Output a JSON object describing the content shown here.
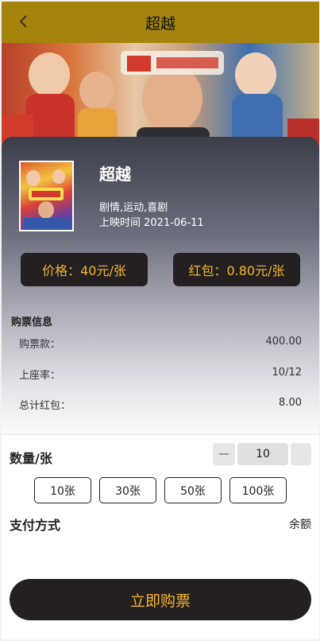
{
  "header": {
    "title": "超越",
    "back_icon": "chevron-left-icon"
  },
  "movie": {
    "title": "超越",
    "genre": "剧情,运动,喜剧",
    "release": "上映时间 2021-06-11"
  },
  "price_pill": "价格：40元/张",
  "bonus_pill": "红包：0.80元/张",
  "ticket_info": {
    "title": "购票信息",
    "rows": [
      {
        "key": "购票款：",
        "value": "400.00"
      },
      {
        "key": "上座率：",
        "value": "10/12"
      },
      {
        "key": "总计红包：",
        "value": "8.00"
      }
    ]
  },
  "quantity": {
    "label": "数量/张",
    "value": "10",
    "presets": [
      "10张",
      "30张",
      "50张",
      "100张"
    ]
  },
  "payment": {
    "label": "支付方式",
    "value": "余额"
  },
  "buy_button": "立即购票",
  "colors": {
    "header": "#a5830d",
    "accent_gold": "#f2b72c",
    "dark": "#241f21"
  }
}
